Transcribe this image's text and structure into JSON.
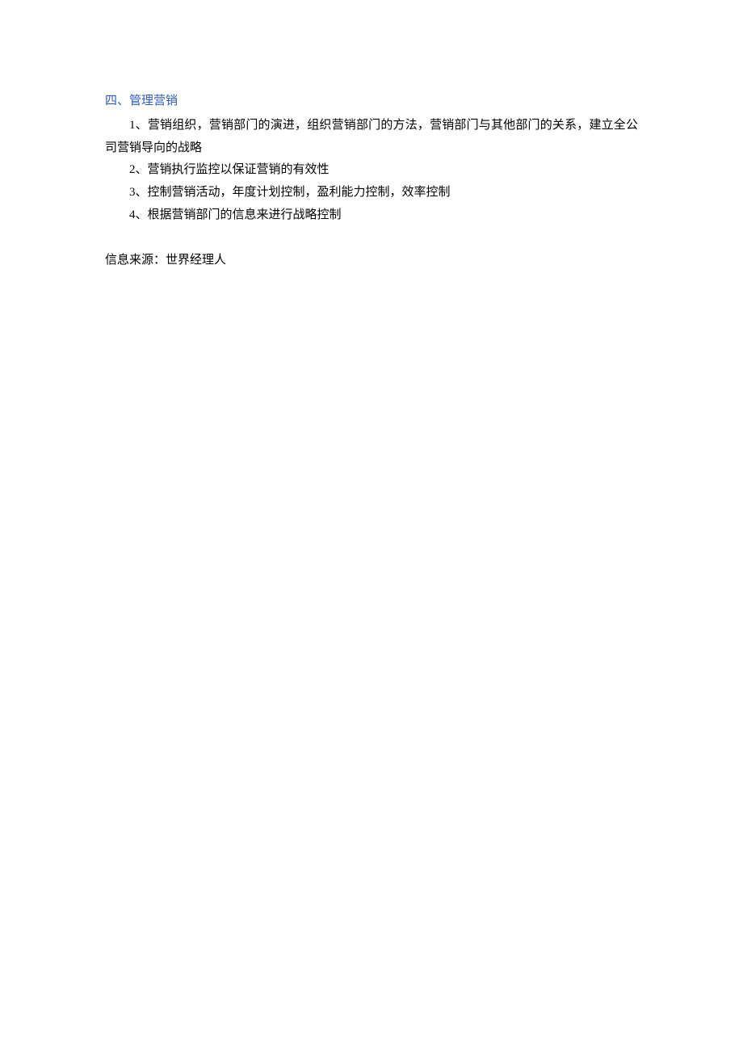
{
  "heading": "四、管理营销",
  "p1": "1、营销组织，营销部门的演进，组织营销部门的方法，营销部门与其他部门的关系，建立全公司营销导向的战略",
  "p2": "2、营销执行监控以保证营销的有效性",
  "p3": "3、控制营销活动，年度计划控制，盈利能力控制，效率控制",
  "p4": "4、根据营销部门的信息来进行战略控制",
  "source": "信息来源：世界经理人"
}
